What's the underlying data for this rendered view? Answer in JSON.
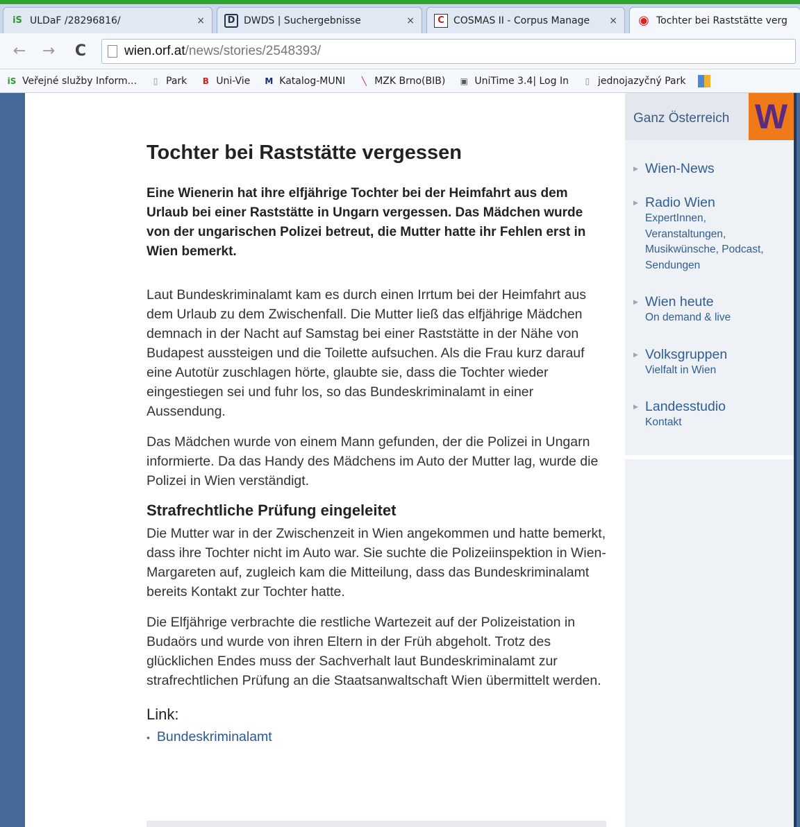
{
  "browser": {
    "tabs": [
      {
        "title": "ULDaF /28296816/",
        "favicon": "iS-icon",
        "favicon_text": "iS"
      },
      {
        "title": "DWDS | Suchergebnisse",
        "favicon": "dwds-icon",
        "favicon_text": "D"
      },
      {
        "title": "COSMAS II - Corpus Manage",
        "favicon": "cosmas-icon",
        "favicon_text": "C"
      },
      {
        "title": "Tochter bei Raststätte verg",
        "favicon": "orf-target-icon",
        "favicon_text": "◉"
      }
    ],
    "close_glyph": "×",
    "url_host": "wien.orf.at",
    "url_path": "/news/stories/2548393/",
    "bookmarks": [
      {
        "label": "Veřejné služby Inform...",
        "icon_text": "iS"
      },
      {
        "label": "Park",
        "icon_text": "▯"
      },
      {
        "label": "Uni-Vie",
        "icon_text": "B"
      },
      {
        "label": "Katalog-MUNI",
        "icon_text": "M"
      },
      {
        "label": "MZK Brno(BIB)",
        "icon_text": "╲"
      },
      {
        "label": "UniTime 3.4| Log In",
        "icon_text": "▣"
      },
      {
        "label": "jednojazyčný Park",
        "icon_text": "▯"
      }
    ]
  },
  "article": {
    "title": "Tochter bei Raststätte vergessen",
    "lead": "Eine Wienerin hat ihre elfjährige Tochter bei der Heimfahrt aus dem Urlaub bei einer Raststätte in Ungarn vergessen. Das Mädchen wurde von der ungarischen Polizei betreut, die Mutter hatte ihr Fehlen erst in Wien bemerkt.",
    "p1": "Laut Bundeskriminalamt kam es durch einen Irrtum bei der Heimfahrt aus dem Urlaub zu dem Zwischenfall. Die Mutter ließ das elfjährige Mädchen demnach in der Nacht auf Samstag bei einer Raststätte in der Nähe von Budapest aussteigen und die Toilette aufsuchen. Als die Frau kurz darauf eine Autotür zuschlagen hörte, glaubte sie, dass die Tochter wieder eingestiegen sei und fuhr los, so das Bundeskriminalamt in einer Aussendung.",
    "p2": "Das Mädchen wurde von einem Mann gefunden, der die Polizei in Ungarn informierte. Da das Handy des Mädchens im Auto der Mutter lag, wurde die Polizei in Wien verständigt.",
    "subheading": "Strafrechtliche Prüfung eingeleitet",
    "p3": "Die Mutter war in der Zwischenzeit in Wien angekommen und hatte bemerkt, dass ihre Tochter nicht im Auto war. Sie suchte die Polizeiinspektion in Wien-Margareten auf, zugleich kam die Mitteilung, dass das Bundeskriminalamt bereits Kontakt zur Tochter hatte.",
    "p4": "Die Elfjährige verbrachte die restliche Wartezeit auf der Polizeistation in Budaörs und wurde von ihren Eltern in der Früh abgeholt. Trotz des glücklichen Endes muss der Sachverhalt laut Bundeskriminalamt zur strafrechtlichen Prüfung an die Staatsanwaltschaft Wien übermittelt werden.",
    "links_heading": "Link:",
    "links": [
      "Bundeskriminalamt"
    ]
  },
  "sidebar": {
    "ganz": "Ganz Österreich",
    "logo": "W",
    "items": [
      {
        "label": "Wien-News",
        "sub": ""
      },
      {
        "label": "Radio Wien",
        "sub": "ExpertInnen, Veranstaltungen, Musikwünsche, Podcast, Sendungen"
      },
      {
        "label": "Wien heute",
        "sub": "On demand & live"
      },
      {
        "label": "Volksgruppen",
        "sub": "Vielfalt in Wien"
      },
      {
        "label": "Landesstudio",
        "sub": "Kontakt"
      }
    ]
  },
  "colors": {
    "accent_blue": "#2f5e93",
    "logo_orange": "#ef7a1a",
    "logo_purple": "#5a2b80",
    "frame_blue": "#46699a"
  }
}
